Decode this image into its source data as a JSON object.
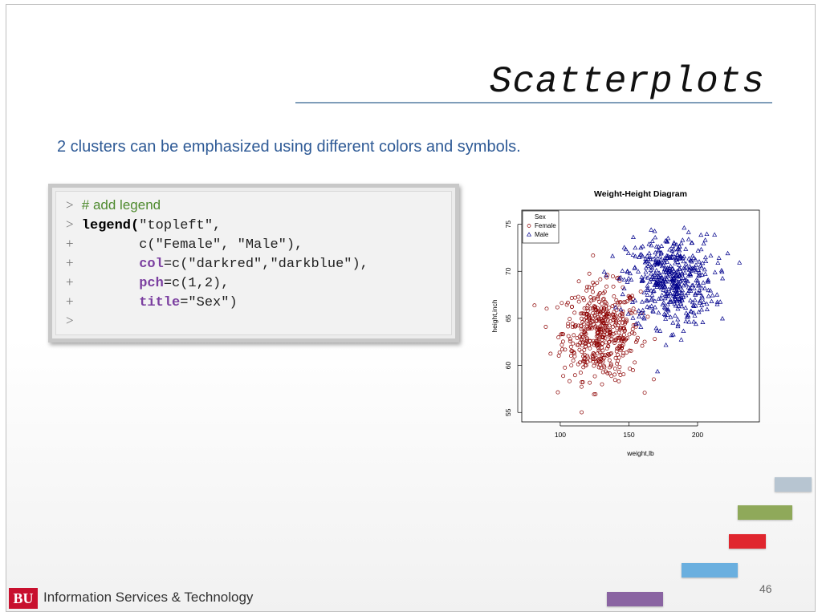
{
  "slide": {
    "title": "Scatterplots",
    "subtitle": "2 clusters can be emphasized using different colors and symbols.",
    "page_number": "46",
    "footer": {
      "logo": "BU",
      "text": "Information Services & Technology"
    }
  },
  "code": {
    "lines": [
      {
        "prompt": ">",
        "comment": "# add legend"
      },
      {
        "prompt": ">",
        "fn": "legend(",
        "rest": "\"topleft\","
      },
      {
        "prompt": "+",
        "indent": "       ",
        "rest": "c(\"Female\", \"Male\"),"
      },
      {
        "prompt": "+",
        "indent": "       ",
        "kw": "col",
        "rest": "=c(\"darkred\",\"darkblue\"),"
      },
      {
        "prompt": "+",
        "indent": "       ",
        "kw": "pch",
        "rest": "=c(1,2),"
      },
      {
        "prompt": "+",
        "indent": "       ",
        "kw": "title",
        "rest": "=\"Sex\")"
      },
      {
        "prompt": ">"
      }
    ]
  },
  "chart_data": {
    "type": "scatter",
    "title": "Weight-Height Diagram",
    "xlabel": "weight,lb",
    "ylabel": "height,inch",
    "xlim": [
      72,
      245
    ],
    "ylim": [
      54,
      76.5
    ],
    "x_ticks": [
      100,
      150,
      200
    ],
    "y_ticks": [
      55,
      60,
      65,
      70,
      75
    ],
    "legend": {
      "title": "Sex",
      "position": "top-left",
      "entries": [
        "Female",
        "Male"
      ]
    },
    "series": [
      {
        "name": "Female",
        "color": "#8b0000",
        "marker": "circle",
        "count": 500,
        "center": {
          "x": 130,
          "y": 63.5
        },
        "spread": {
          "x": 14,
          "y": 2.5
        }
      },
      {
        "name": "Male",
        "color": "#00008b",
        "marker": "triangle",
        "count": 500,
        "center": {
          "x": 180,
          "y": 69
        },
        "spread": {
          "x": 16,
          "y": 2.4
        }
      }
    ]
  },
  "decor": {
    "bars": [
      {
        "name": "bar-grey",
        "color": "#b7c5d1"
      },
      {
        "name": "bar-green",
        "color": "#8fa95a"
      },
      {
        "name": "bar-red",
        "color": "#e0262e"
      },
      {
        "name": "bar-blue",
        "color": "#6aafdf"
      },
      {
        "name": "bar-purple",
        "color": "#8a64a2"
      }
    ]
  }
}
